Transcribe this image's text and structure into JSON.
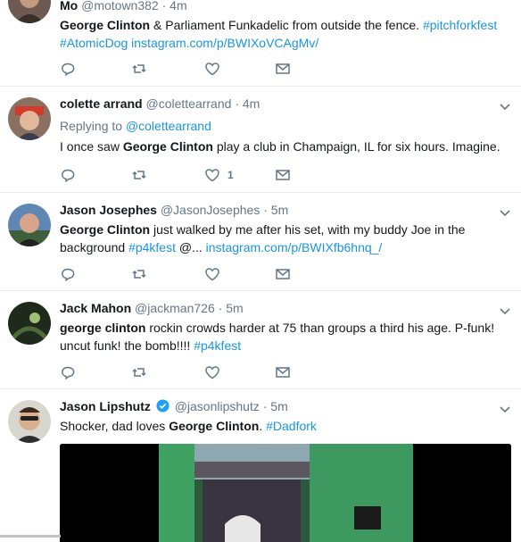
{
  "colors": {
    "link": "#1b95e0",
    "muted": "#657786",
    "text": "#14171a",
    "verified": "#1da1f2"
  },
  "tweets": [
    {
      "name": "Mo",
      "handle": "@motown382",
      "sep": "·",
      "time": "4m",
      "text_parts": {
        "t1": "George Clinton",
        "t2": " & Parliament Funkadelic from outside the fence. ",
        "l1": "#pitchforkfest",
        "l2": "#AtomicDog",
        "l3": "instagram.com/p/BWIXoVCAgMv/"
      },
      "like_count": ""
    },
    {
      "name": "colette arrand",
      "handle": "@colettearrand",
      "sep": "·",
      "time": "4m",
      "replying_label": "Replying to",
      "replying_to": "@colettearrand",
      "text_parts": {
        "t1": "I once saw ",
        "t2": "George Clinton",
        "t3": " play a club in Champaign, IL for six hours. Imagine."
      },
      "like_count": "1"
    },
    {
      "name": "Jason Josephes",
      "handle": "@JasonJosephes",
      "sep": "·",
      "time": "5m",
      "text_parts": {
        "t1": "George Clinton",
        "t2": " just walked by me after his set, with my buddy Joe in the background ",
        "l1": "#p4kfest",
        "t3": " @... ",
        "l2": "instagram.com/p/BWIXfb6hnq_/"
      },
      "like_count": ""
    },
    {
      "name": "Jack Mahon",
      "handle": "@jackman726",
      "sep": "·",
      "time": "5m",
      "text_parts": {
        "t1": "george clinton",
        "t2": " rockin crowds harder at 75 than groups a third his age. P-funk! uncut funk! the bomb!!!! ",
        "l1": "#p4kfest"
      },
      "like_count": ""
    },
    {
      "name": "Jason Lipshutz",
      "handle": "@jasonlipshutz",
      "sep": "·",
      "time": "5m",
      "text_parts": {
        "t1": "Shocker, dad loves ",
        "t2": "George Clinton",
        "t3": ". ",
        "l1": "#Dadfork"
      },
      "like_count": ""
    }
  ]
}
